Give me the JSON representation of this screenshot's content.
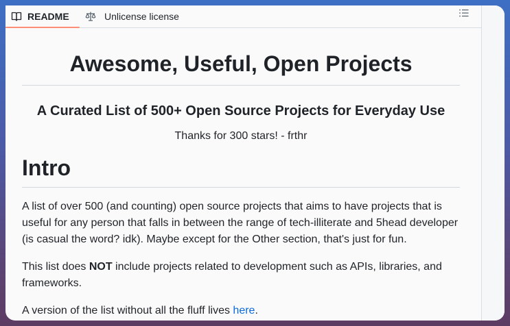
{
  "tabs": {
    "readme": "README",
    "license": "Unlicense license"
  },
  "readme": {
    "title": "Awesome, Useful, Open Projects",
    "subtitle": "A Curated List of 500+ Open Source Projects for Everyday Use",
    "thanks": "Thanks for 300 stars! - frthr",
    "intro_heading": "Intro",
    "intro_paragraph": "A list of over 500 (and counting) open source projects that aims to have projects that is useful for any person that falls in between the range of tech-illiterate and 5head developer (is casual the word? idk). Maybe except for the Other section, that's just for fun.",
    "not_paragraph": {
      "before": "This list does ",
      "bold": "NOT",
      "after": " include projects related to development such as APIs, libraries, and frameworks."
    },
    "version_paragraph": {
      "before": "A version of the list without all the fluff lives ",
      "link": "here",
      "after": "."
    }
  },
  "icons": {
    "readme_tab": "book-icon",
    "license_tab": "law-scale-icon",
    "toc": "list-unordered-icon"
  },
  "colors": {
    "active_tab_underline": "#fd8c73",
    "link": "#0969da"
  }
}
